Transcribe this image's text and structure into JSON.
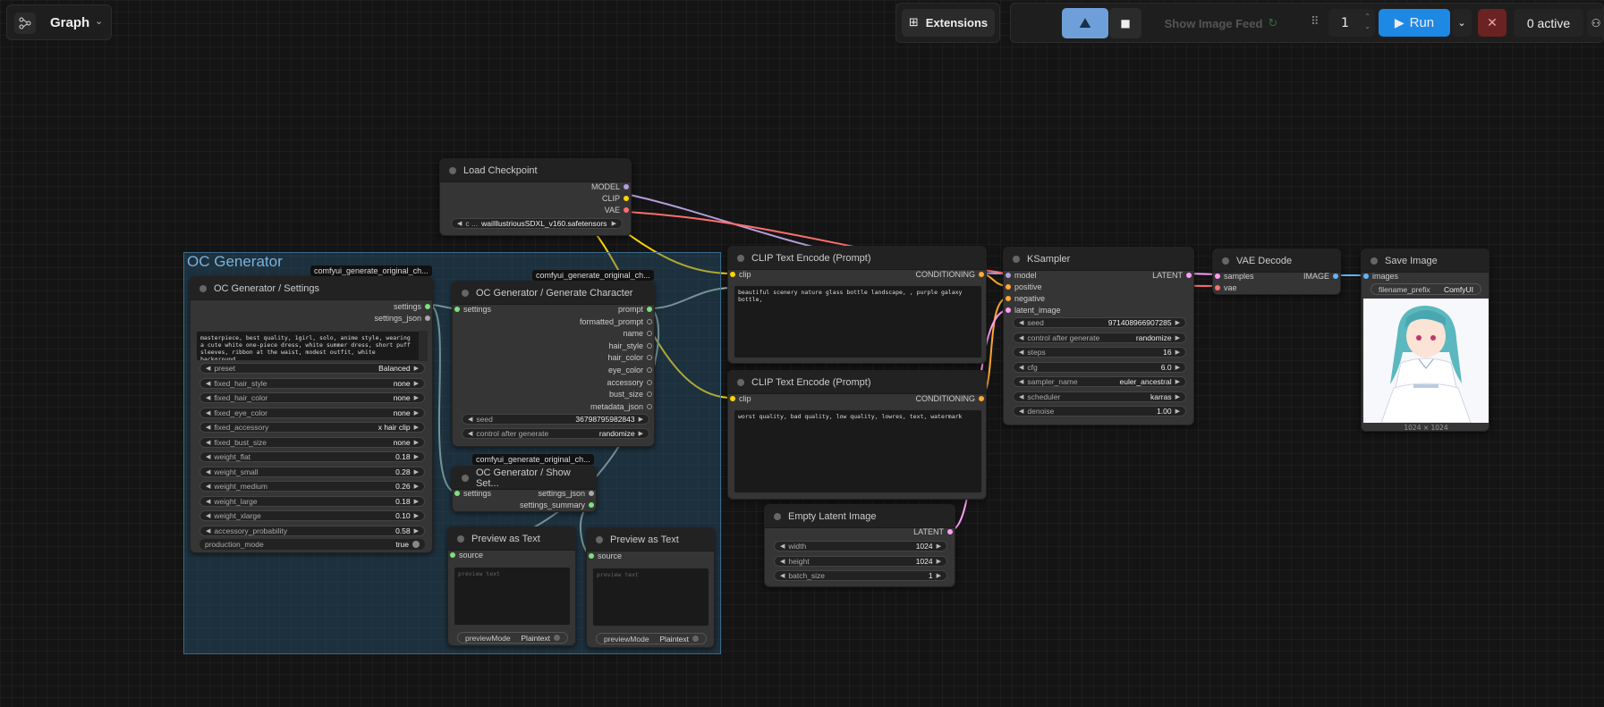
{
  "topbar": {
    "graph_label": "Graph",
    "extensions_label": "Extensions",
    "show_image_feed_label": "Show Image Feed",
    "queue_count": "1",
    "run_label": "Run",
    "active_label": "0 active"
  },
  "group": {
    "title": "OC Generator"
  },
  "badges": {
    "settings": "comfyui_generate_original_ch...",
    "generate": "comfyui_generate_original_ch...",
    "show_settings": "comfyui_generate_original_ch..."
  },
  "load_checkpoint": {
    "title": "Load Checkpoint",
    "outputs": [
      "MODEL",
      "CLIP",
      "VAE"
    ],
    "ckpt_prefix": "c ...",
    "ckpt_value": "waiIllustriousSDXL_v160.safetensors"
  },
  "oc_settings": {
    "title": "OC Generator / Settings",
    "outputs": [
      "settings",
      "settings_json"
    ],
    "prompt_text": "masterpiece, best quality, 1girl, solo, anime style, wearing a cute white one-piece dress, white summer dress, short puff sleeves, ribbon at the waist, modest outfit, white background,",
    "widgets": [
      {
        "label": "preset",
        "value": "Balanced"
      },
      {
        "label": "fixed_hair_style",
        "value": "none"
      },
      {
        "label": "fixed_hair_color",
        "value": "none"
      },
      {
        "label": "fixed_eye_color",
        "value": "none"
      },
      {
        "label": "fixed_accessory",
        "value": "x hair clip"
      },
      {
        "label": "fixed_bust_size",
        "value": "none"
      },
      {
        "label": "weight_flat",
        "value": "0.18"
      },
      {
        "label": "weight_small",
        "value": "0.28"
      },
      {
        "label": "weight_medium",
        "value": "0.26"
      },
      {
        "label": "weight_large",
        "value": "0.18"
      },
      {
        "label": "weight_xlarge",
        "value": "0.10"
      },
      {
        "label": "accessory_probability",
        "value": "0.58"
      }
    ],
    "toggle_label": "production_mode",
    "toggle_value": "true"
  },
  "oc_generate": {
    "title": "OC Generator / Generate Character",
    "input": "settings",
    "outputs": [
      "prompt",
      "formatted_prompt",
      "name",
      "hair_style",
      "hair_color",
      "eye_color",
      "accessory",
      "bust_size",
      "metadata_json"
    ],
    "seed_label": "seed",
    "seed_value": "367987959828­43",
    "cag_label": "control after generate",
    "cag_value": "randomize"
  },
  "oc_show": {
    "title": "OC Generator / Show Set...",
    "input": "settings",
    "outputs": [
      "settings_json",
      "settings_summary"
    ]
  },
  "preview1": {
    "title": "Preview as Text",
    "input": "source",
    "placeholder": "preview text",
    "mode_label": "previewMode",
    "mode_value": "Plaintext"
  },
  "preview2": {
    "title": "Preview as Text",
    "input": "source",
    "placeholder": "preview text",
    "mode_label": "previewMode",
    "mode_value": "Plaintext"
  },
  "clip1": {
    "title": "CLIP Text Encode (Prompt)",
    "input": "clip",
    "output": "CONDITIONING",
    "text": "beautiful scenery nature glass bottle landscape, , purple galaxy bottle,"
  },
  "clip2": {
    "title": "CLIP Text Encode (Prompt)",
    "input": "clip",
    "output": "CONDITIONING",
    "text": "worst quality, bad quality, low quality, lowres, text, watermark"
  },
  "ksampler": {
    "title": "KSampler",
    "inputs": [
      "model",
      "positive",
      "negative",
      "latent_image"
    ],
    "output": "LATENT",
    "widgets": [
      {
        "label": "seed",
        "value": "971408966907285"
      },
      {
        "label": "control after generate",
        "value": "randomize"
      },
      {
        "label": "steps",
        "value": "16"
      },
      {
        "label": "cfg",
        "value": "6.0"
      },
      {
        "label": "sampler_name",
        "value": "euler_ancestral"
      },
      {
        "label": "scheduler",
        "value": "karras"
      },
      {
        "label": "denoise",
        "value": "1.00"
      }
    ]
  },
  "vae_decode": {
    "title": "VAE Decode",
    "inputs": [
      "samples",
      "vae"
    ],
    "output": "IMAGE"
  },
  "save_image": {
    "title": "Save Image",
    "input": "images",
    "prefix_label": "filename_prefix",
    "prefix_value": "ComfyUI",
    "size_caption": "1024 × 1024"
  },
  "empty_latent": {
    "title": "Empty Latent Image",
    "output": "LATENT",
    "widgets": [
      {
        "label": "width",
        "value": "1024"
      },
      {
        "label": "height",
        "value": "1024"
      },
      {
        "label": "batch_size",
        "value": "1"
      }
    ]
  },
  "colors": {
    "model": "#b39ddb",
    "clip": "#ffd500",
    "vae": "#ff6e6e",
    "conditioning": "#ffa931",
    "latent": "#ff9cf9",
    "image": "#64b5f6",
    "generic": "#a0b8a0",
    "run": "#1e88e5"
  }
}
